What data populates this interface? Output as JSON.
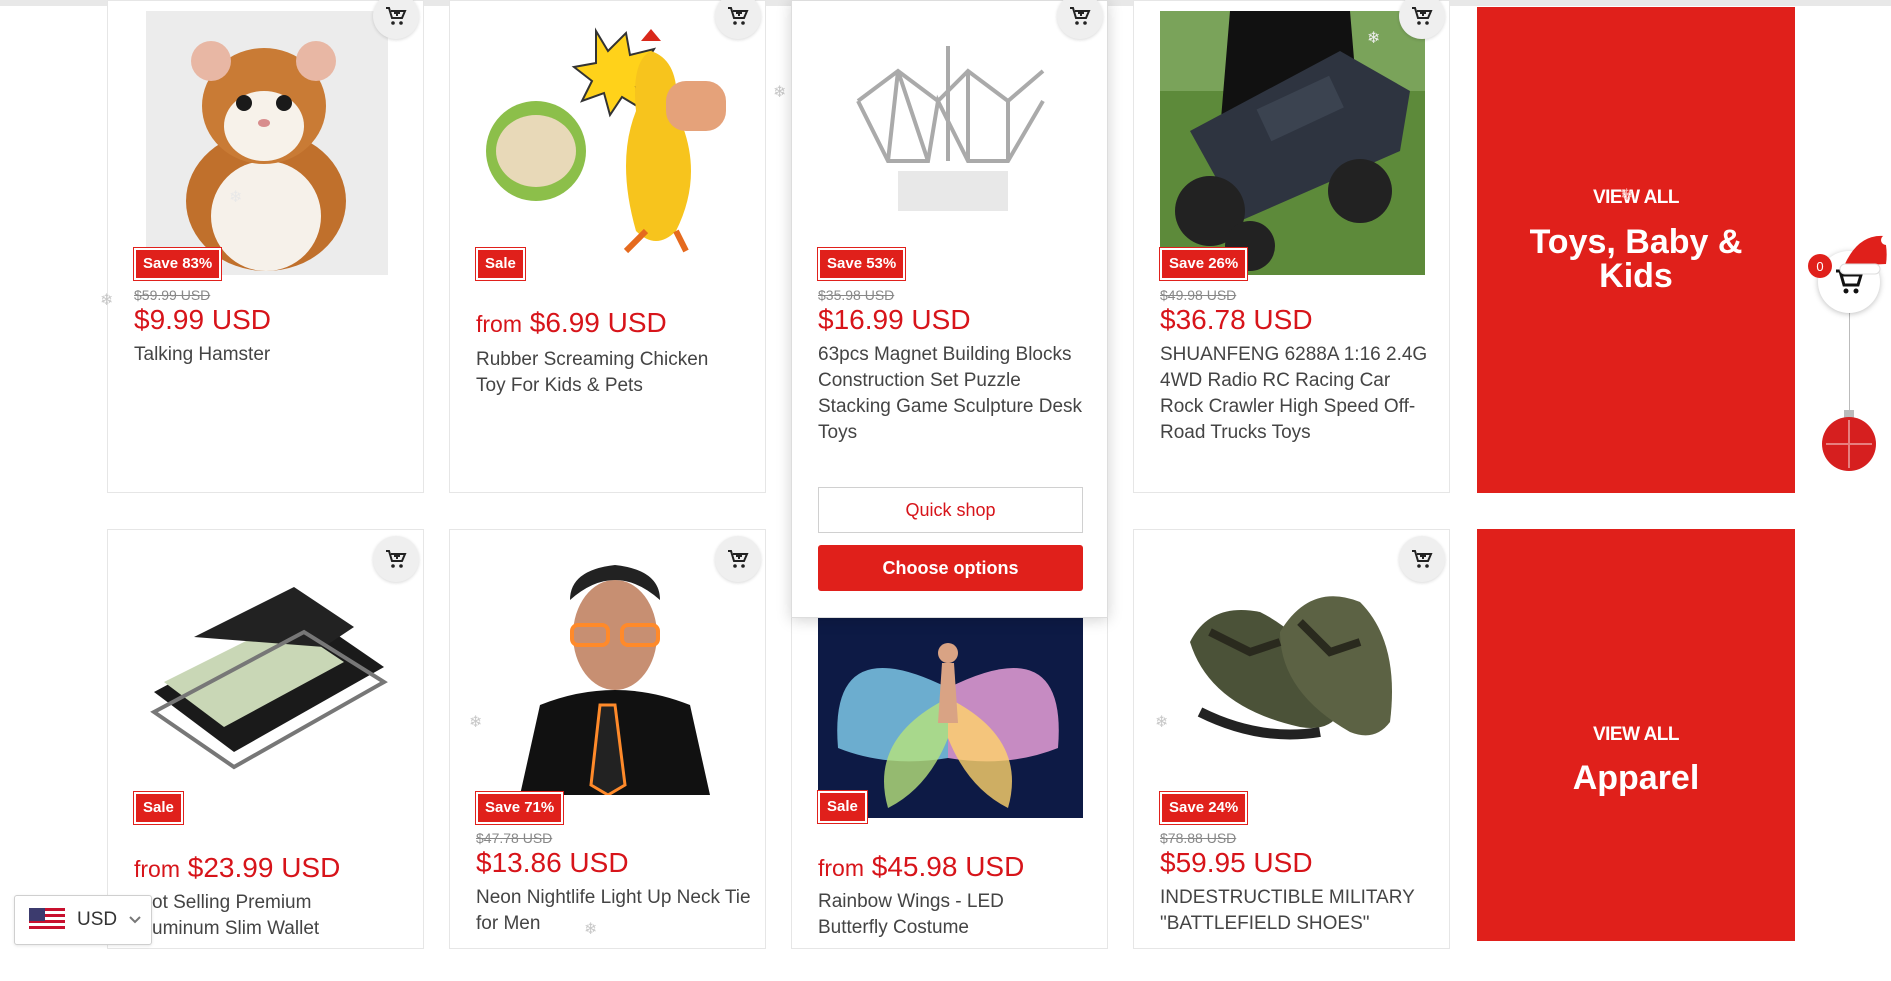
{
  "products": [
    {
      "badge": "Save 83%",
      "old_price": "$59.99 USD",
      "price_prefix": "",
      "price": "$9.99 USD",
      "title": "Talking Hamster"
    },
    {
      "badge": "Sale",
      "old_price": "",
      "price_prefix": "from",
      "price": "$6.99 USD",
      "title": "Rubber Screaming Chicken Toy For Kids & Pets"
    },
    {
      "badge": "Save 53%",
      "old_price": "$35.98 USD",
      "price_prefix": "",
      "price": "$16.99 USD",
      "title": "63pcs Magnet Building Blocks Construction Set Puzzle Stacking Game Sculpture Desk Toys",
      "quick_shop": "Quick shop",
      "choose_options": "Choose options"
    },
    {
      "badge": "Save 26%",
      "old_price": "$49.98 USD",
      "price_prefix": "",
      "price": "$36.78 USD",
      "title": "SHUANFENG 6288A 1:16 2.4G 4WD Radio RC Racing Car Rock Crawler High Speed Off-Road Trucks Toys"
    },
    {
      "badge": "Sale",
      "old_price": "",
      "price_prefix": "from",
      "price": "$23.99 USD",
      "title": "ot Selling Premium uminum Slim Wallet"
    },
    {
      "badge": "Save 71%",
      "old_price": "$47.78 USD",
      "price_prefix": "",
      "price": "$13.86 USD",
      "title": "Neon Nightlife Light Up Neck Tie for Men"
    },
    {
      "badge": "Sale",
      "old_price": "",
      "price_prefix": "from",
      "price": "$45.98 USD",
      "title": "Rainbow Wings - LED Butterfly Costume"
    },
    {
      "badge": "Save 24%",
      "old_price": "$78.88 USD",
      "price_prefix": "",
      "price": "$59.95 USD",
      "title": "INDESTRUCTIBLE MILITARY \"BATTLEFIELD SHOES\""
    }
  ],
  "promos": [
    {
      "view_all": "VIEW ALL",
      "category": "Toys, Baby & Kids"
    },
    {
      "view_all": "VIEW ALL",
      "category": "Apparel"
    }
  ],
  "currency": {
    "code": "USD"
  },
  "cart": {
    "count": "0"
  },
  "colors": {
    "accent": "#e0201b",
    "price": "#d7141a"
  }
}
